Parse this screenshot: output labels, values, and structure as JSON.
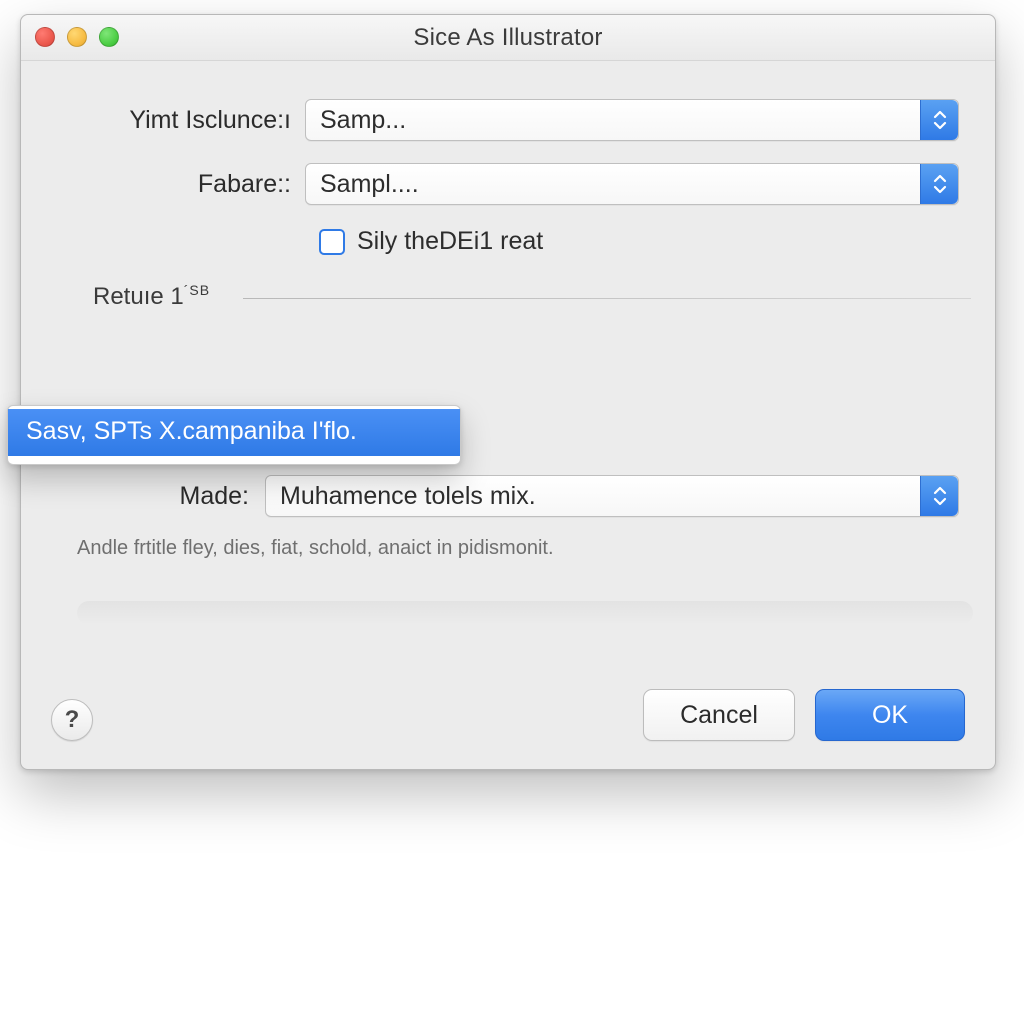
{
  "window": {
    "title": "Sice As Illustrator"
  },
  "form": {
    "row1": {
      "label": "Yimt Isclunce:ı",
      "value": "Samp..."
    },
    "row2": {
      "label": "Fabare::",
      "value": "Sampl...."
    },
    "checkbox_label": "Sily theDEi1 reat",
    "group_header": "Retuıe 1",
    "group_header_sup": "´SB",
    "menu_item": "Sasv, SPTs X.campaniba I'flo.",
    "made": {
      "label": "Made:",
      "value": "Muhamence tolels mix."
    },
    "description": "Andle frtitle fley, dies, fiat, schold, anaict in pidismonit."
  },
  "footer": {
    "help": "?",
    "cancel": "Cancel",
    "ok": "OK"
  }
}
